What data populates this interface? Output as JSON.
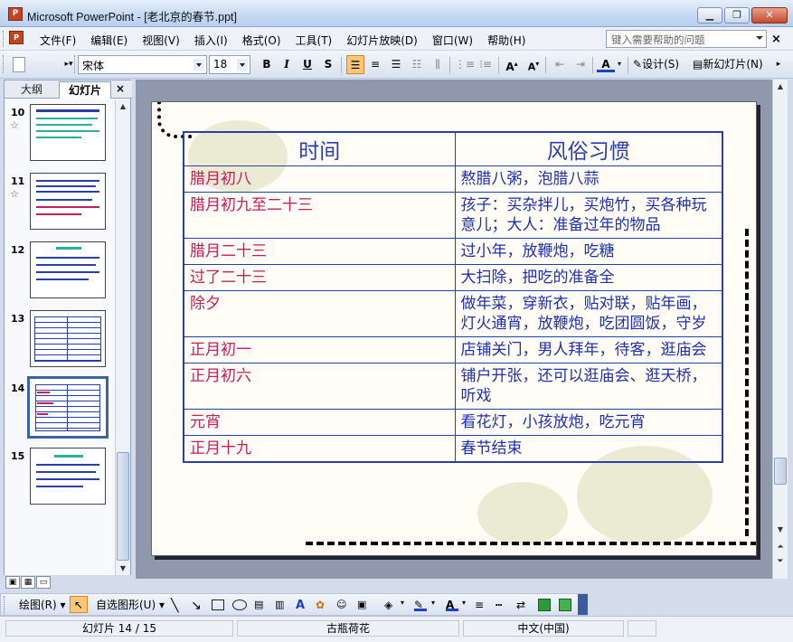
{
  "window": {
    "title": "Microsoft PowerPoint - [老北京的春节.ppt]",
    "app_icon": "powerpoint-icon",
    "controls": [
      "minimize",
      "restore",
      "close"
    ]
  },
  "menu": {
    "items": [
      "文件(F)",
      "编辑(E)",
      "视图(V)",
      "插入(I)",
      "格式(O)",
      "工具(T)",
      "幻灯片放映(D)",
      "窗口(W)",
      "帮助(H)"
    ],
    "help_placeholder": "键入需要帮助的问题"
  },
  "toolbar": {
    "font_name": "宋体",
    "font_size": "18",
    "bold": "B",
    "italic": "I",
    "underline": "U",
    "shadow": "S",
    "design_label": "设计(S)",
    "new_slide_label": "新幻灯片(N)"
  },
  "panel": {
    "tab_outline": "大纲",
    "tab_slides": "幻灯片",
    "close": "×",
    "slides": [
      {
        "num": "10",
        "star": true
      },
      {
        "num": "11",
        "star": true
      },
      {
        "num": "12",
        "star": false
      },
      {
        "num": "13",
        "star": false
      },
      {
        "num": "14",
        "star": false,
        "selected": true
      },
      {
        "num": "15",
        "star": false
      }
    ]
  },
  "slide": {
    "header": {
      "time": "时间",
      "custom": "风俗习惯"
    },
    "rows": [
      {
        "time": "腊月初八",
        "custom": "熬腊八粥，泡腊八蒜"
      },
      {
        "time": "腊月初九至二十三",
        "custom": "孩子：买杂拌儿，买炮竹，买各种玩意儿；大人：准备过年的物品"
      },
      {
        "time": "腊月二十三",
        "custom": "过小年，放鞭炮，吃糖"
      },
      {
        "time": "过了二十三",
        "custom": "大扫除，把吃的准备全"
      },
      {
        "time": "除夕",
        "custom": "做年菜，穿新衣，贴对联，贴年画，灯火通宵，放鞭炮，吃团圆饭，守岁"
      },
      {
        "time": "正月初一",
        "custom": "店铺关门，男人拜年，待客，逛庙会"
      },
      {
        "time": "正月初六",
        "custom": "铺户开张，还可以逛庙会、逛天桥，听戏"
      },
      {
        "time": "元宵",
        "custom": "看花灯，小孩放炮，吃元宵"
      },
      {
        "time": "正月十九",
        "custom": "春节结束"
      }
    ]
  },
  "drawbar": {
    "draw_label": "绘图(R)",
    "autoshape_label": "自选图形(U)"
  },
  "status": {
    "slide_pos": "幻灯片 14 / 15",
    "design": "古瓶荷花",
    "language": "中文(中国)"
  },
  "colors": {
    "table_border": "#2a3fa8",
    "time_text": "#c0205c",
    "custom_text": "#2030a8"
  }
}
